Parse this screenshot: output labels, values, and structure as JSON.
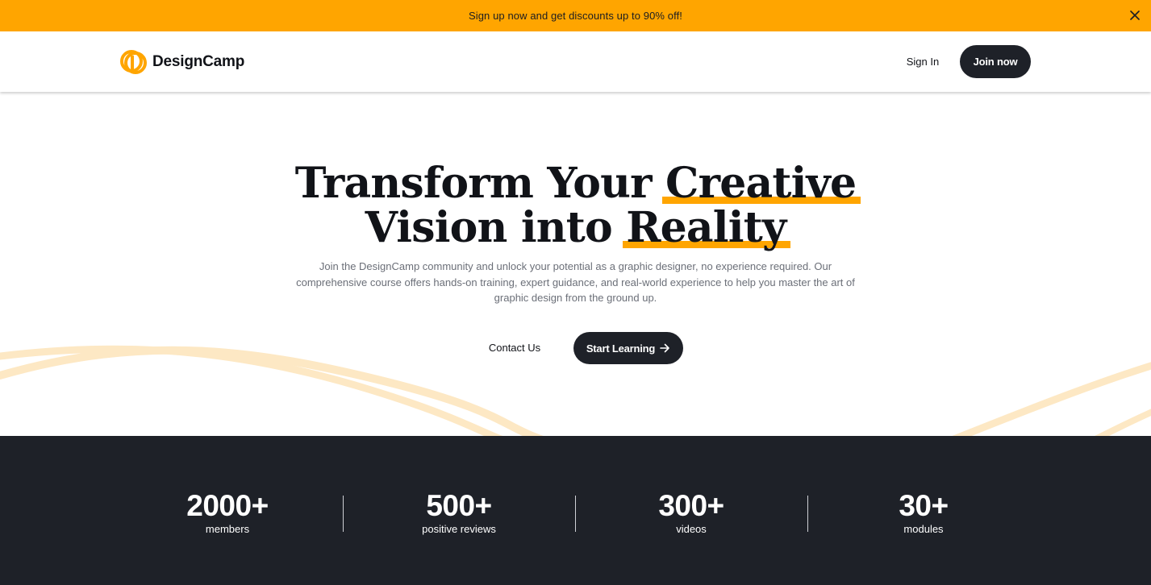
{
  "promo": {
    "text": "Sign up now and get discounts up to 90% off!",
    "close_icon": "close-icon",
    "background": "#ffa500"
  },
  "nav": {
    "brand": "DesignCamp",
    "logo_icon": "designcamp-logo-icon",
    "sign_in": "Sign In",
    "join_now": "Join now"
  },
  "hero": {
    "headline": {
      "line1_prefix": "Transform Your ",
      "line1_highlight": "Creative",
      "line2_prefix": "Vision into ",
      "line2_highlight": "Reality"
    },
    "description": "Join the DesignCamp community and unlock your potential as a graphic designer, no experience required. Our comprehensive course offers hands-on training, expert guidance, and real-world experience to help you master the art of graphic design from the ground up.",
    "contact_label": "Contact Us",
    "start_label": "Start Learning",
    "start_icon": "arrow-right-icon"
  },
  "stats": [
    {
      "value": "2000+",
      "label": "members"
    },
    {
      "value": "500+",
      "label": "positive reviews"
    },
    {
      "value": "300+",
      "label": "videos"
    },
    {
      "value": "30+",
      "label": "modules"
    }
  ],
  "colors": {
    "accent": "#ffa500",
    "dark": "#1e2128",
    "wave": "#fde8c4"
  }
}
